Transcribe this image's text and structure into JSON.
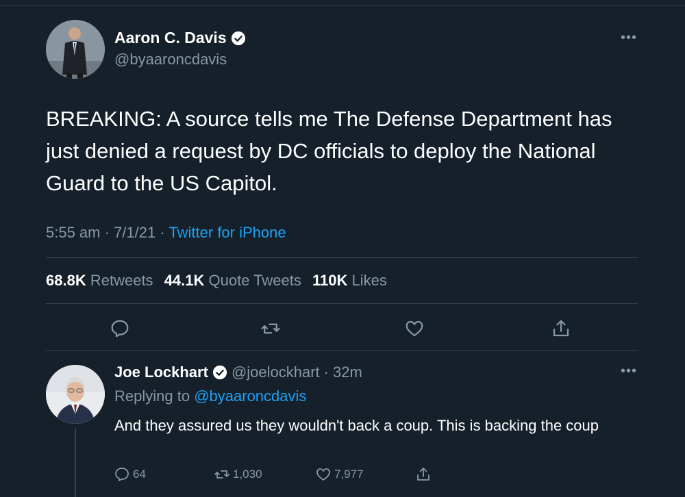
{
  "tweet": {
    "author_name": "Aaron C. Davis",
    "author_handle": "@byaaroncdavis",
    "text": "BREAKING: A source tells me The Defense Department has just denied a request by DC officials to deploy the National Guard to the US Capitol.",
    "time": "5:55 am",
    "date": "7/1/21",
    "source": "Twitter for iPhone",
    "retweets_count": "68.8K",
    "retweets_label": "Retweets",
    "quotes_count": "44.1K",
    "quotes_label": "Quote Tweets",
    "likes_count": "110K",
    "likes_label": "Likes"
  },
  "reply": {
    "author_name": "Joe Lockhart",
    "author_handle": "@joelockhart",
    "time": "32m",
    "replying_prefix": "Replying to",
    "replying_to": "@byaaroncdavis",
    "text": "And they assured us they wouldn't back a coup.  This is backing the coup",
    "reply_count": "64",
    "retweet_count": "1,030",
    "like_count": "7,977"
  },
  "icons": {
    "verified": "verified-badge-icon",
    "more": "more-icon",
    "reply": "reply-icon",
    "retweet": "retweet-icon",
    "like": "heart-icon",
    "share": "share-icon"
  },
  "colors": {
    "background": "#15202b",
    "accent": "#1da1f2",
    "muted": "#8899a6",
    "divider": "#38444d"
  }
}
